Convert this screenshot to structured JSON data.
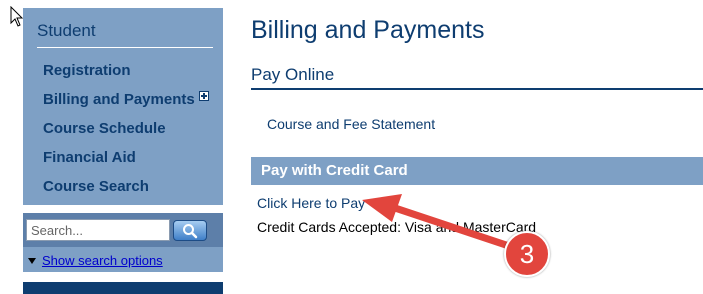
{
  "sidebar": {
    "header": "Student",
    "items": [
      {
        "label": "Registration"
      },
      {
        "label": "Billing and Payments"
      },
      {
        "label": "Course Schedule"
      },
      {
        "label": "Financial Aid"
      },
      {
        "label": "Course Search"
      }
    ]
  },
  "search": {
    "placeholder": "Search...",
    "options_label": "Show search options"
  },
  "main": {
    "title": "Billing and Payments",
    "section_heading": "Pay Online",
    "statement_link": "Course and Fee Statement",
    "credit_card": {
      "header": "Pay with Credit Card",
      "pay_link": "Click Here to Pay",
      "accepted_text": "Credit Cards Accepted: Visa and MasterCard"
    }
  },
  "annotation": {
    "step_number": "3",
    "color": "#e2453d"
  },
  "colors": {
    "brand_navy": "#0e3d70",
    "sidebar_blue": "#7ea0c5"
  }
}
